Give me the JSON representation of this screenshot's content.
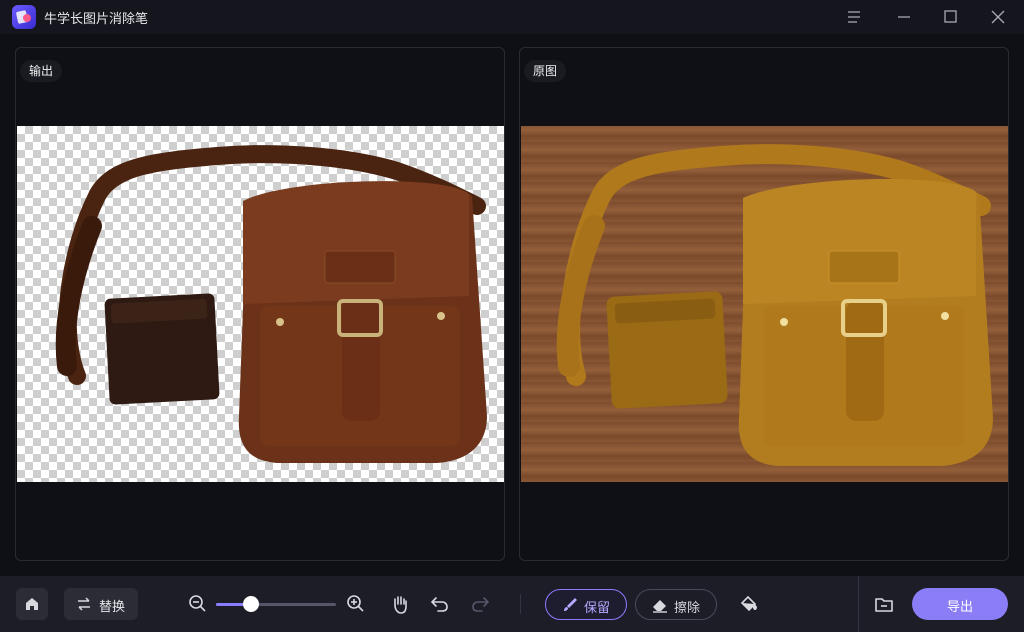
{
  "app": {
    "title": "牛学长图片消除笔",
    "logo_icon": "app-logo-icon"
  },
  "window_controls": [
    "menu-icon",
    "minimize-icon",
    "maximize-icon",
    "close-icon"
  ],
  "panels": {
    "output": {
      "label": "输出",
      "background": "transparent-checkerboard"
    },
    "original": {
      "label": "原图",
      "background": "wood"
    }
  },
  "toolbar": {
    "home_icon": "home-icon",
    "replace_label": "替换",
    "zoom_out_icon": "zoom-out-icon",
    "zoom_in_icon": "zoom-in-icon",
    "zoom_level": 0.29,
    "hand_icon": "hand-icon",
    "undo_icon": "undo-icon",
    "redo_icon": "redo-icon",
    "keep_label": "保留",
    "erase_label": "擦除",
    "fill_icon": "paint-bucket-icon",
    "folder_icon": "folder-icon",
    "export_label": "导出"
  },
  "colors": {
    "accent": "#8b7df5",
    "background": "#0f1016",
    "toolbar": "#1c1d26",
    "highlight_overlay": "#c88a1a"
  }
}
